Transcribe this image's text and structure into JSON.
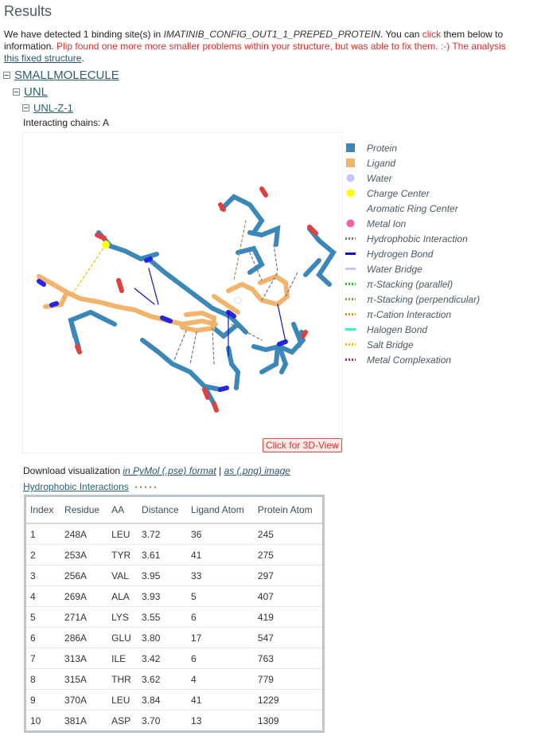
{
  "page": {
    "heading": "Results"
  },
  "intro": {
    "pre": "We have detected 1 binding site(s) in ",
    "protein": "IMATINIB_CONFIG_OUT1_1_PREPED_PROTEIN",
    "mid": ". You can ",
    "click": "click",
    "post": " them below to",
    "line2_pre": "information. ",
    "warning": "Plip found one more more smaller problems within your structure, but was able to fix them. :-) The analysis",
    "link": "this fixed structure",
    "period": "."
  },
  "tree": {
    "level1": "SMALLMOLECULE",
    "level2": "UNL",
    "level3": "UNL-Z-1",
    "chains": "Interacting chains: A"
  },
  "viz": {
    "button": "Click for 3D-View"
  },
  "legend": [
    {
      "label": "Protein",
      "color": "#3a87b8",
      "icon": "square-checker-icon"
    },
    {
      "label": "Ligand",
      "color": "#f2b36d",
      "icon": "square-checker-icon"
    },
    {
      "label": "Water",
      "color": "#c9c4f5",
      "icon": "dot-icon"
    },
    {
      "label": "Charge Center",
      "color": "#ffff00",
      "icon": "dot-icon"
    },
    {
      "label": "Aromatic Ring Center",
      "color": "#ffffff",
      "icon": "dot-icon"
    },
    {
      "label": "Metal Ion",
      "color": "#f062a0",
      "icon": "dot-icon"
    },
    {
      "label": "Hydrophobic Interaction",
      "color": "#777777",
      "icon": "dotted-line-icon"
    },
    {
      "label": "Hydrogen Bond",
      "color": "#1010c8",
      "icon": "solid-line-icon"
    },
    {
      "label": "Water Bridge",
      "color": "#c9c4f5",
      "icon": "solid-line-icon"
    },
    {
      "label": "π-Stacking (parallel)",
      "color": "#22cc22",
      "icon": "dotted-line-icon"
    },
    {
      "label": "π-Stacking (perpendicular)",
      "color": "#8aa050",
      "icon": "dotted-line-icon"
    },
    {
      "label": "π-Cation Interaction",
      "color": "#f08c2a",
      "icon": "dotted-line-icon"
    },
    {
      "label": "Halogen Bond",
      "color": "#3cf0c8",
      "icon": "solid-line-icon"
    },
    {
      "label": "Salt Bridge",
      "color": "#f0c000",
      "icon": "dotted-line-icon"
    },
    {
      "label": "Metal Complexation",
      "color": "#8a3a8a",
      "icon": "dotted-line-icon"
    }
  ],
  "download": {
    "prefix": "Download visualization ",
    "pymol": "in PyMol (.pse) format",
    "sep": " | ",
    "png": "as (.png) image"
  },
  "hydrophobic": {
    "title": "Hydrophobic Interactions",
    "columns": [
      "Index",
      "Residue",
      "AA",
      "Distance",
      "Ligand Atom",
      "Protein Atom"
    ],
    "rows": [
      [
        "1",
        "248A",
        "LEU",
        "3.72",
        "36",
        "245"
      ],
      [
        "2",
        "253A",
        "TYR",
        "3.61",
        "41",
        "275"
      ],
      [
        "3",
        "256A",
        "VAL",
        "3.95",
        "33",
        "297"
      ],
      [
        "4",
        "269A",
        "ALA",
        "3.93",
        "5",
        "407"
      ],
      [
        "5",
        "271A",
        "LYS",
        "3.55",
        "6",
        "419"
      ],
      [
        "6",
        "286A",
        "GLU",
        "3.80",
        "17",
        "547"
      ],
      [
        "7",
        "313A",
        "ILE",
        "3.42",
        "6",
        "763"
      ],
      [
        "8",
        "315A",
        "THR",
        "3.62",
        "4",
        "779"
      ],
      [
        "9",
        "370A",
        "LEU",
        "3.84",
        "41",
        "1229"
      ],
      [
        "10",
        "381A",
        "ASP",
        "3.70",
        "13",
        "1309"
      ]
    ]
  }
}
